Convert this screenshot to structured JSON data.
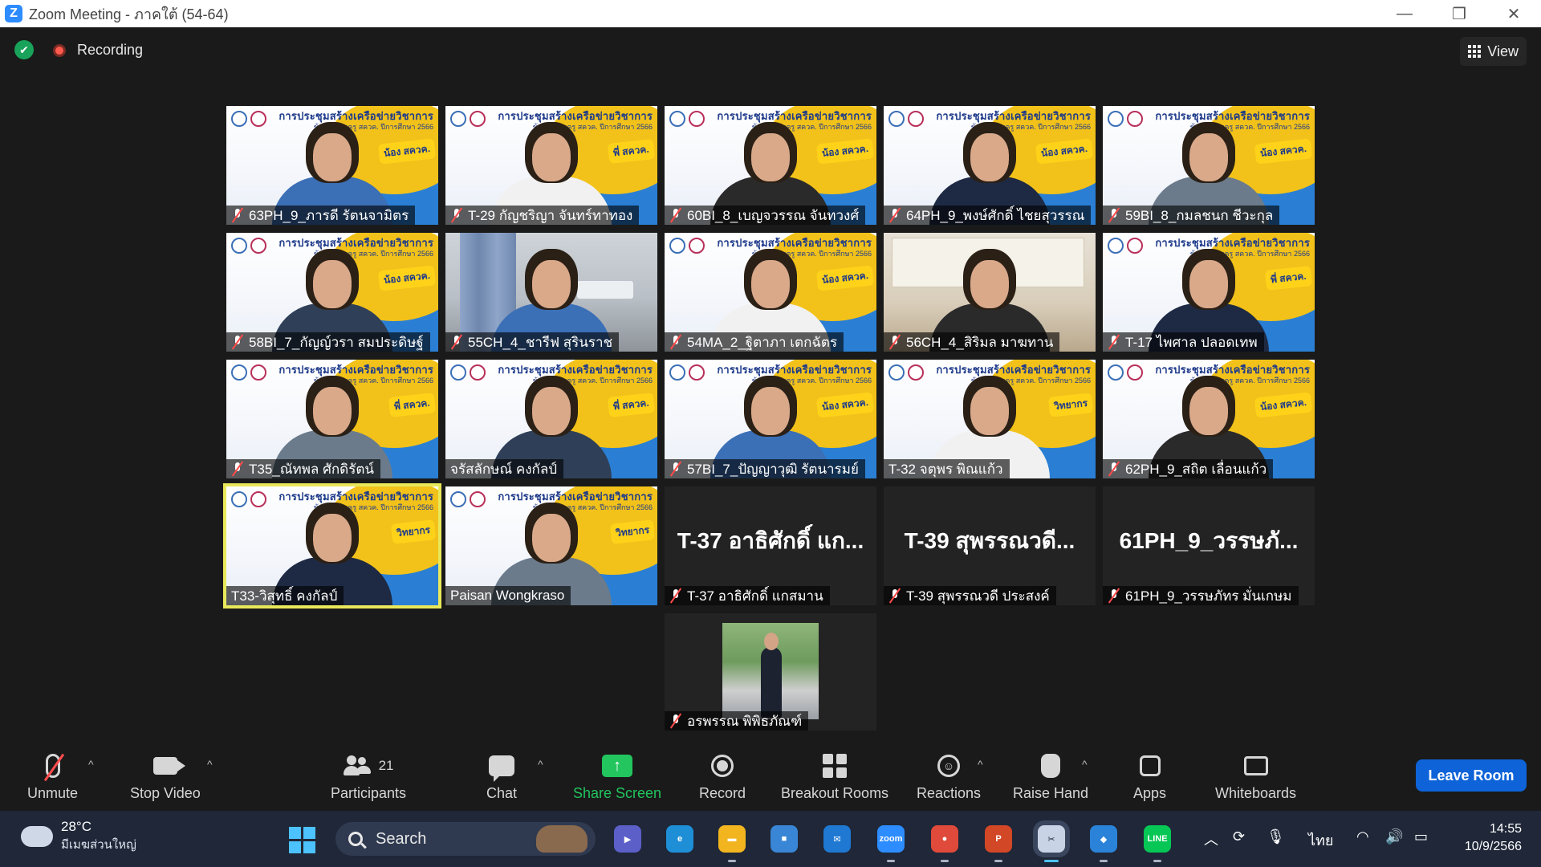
{
  "window": {
    "title": "Zoom Meeting - ภาคใต้ (54-64)",
    "controls": {
      "minimize": "—",
      "restore": "❐",
      "close": "✕"
    }
  },
  "topbar": {
    "security_icon": "shield-check-icon",
    "recording_label": "Recording",
    "view_label": "View"
  },
  "banner": {
    "title": "การประชุมสร้างเครือข่ายวิชาการ",
    "subtitle": "ข้าราชการครู สควค. ปีการศึกษา 2566",
    "tag_student": "น้อง สควค.",
    "tag_senior": "พี่ สควค.",
    "tag_speaker": "วิทยากร"
  },
  "participants": [
    {
      "name": "63PH_9_ภารดี รัตนจามิตร",
      "muted": true,
      "video": "banner",
      "tag": "student"
    },
    {
      "name": "T-29 กัญชริญา  จันทร์ทาทอง",
      "muted": true,
      "video": "banner",
      "tag": "senior"
    },
    {
      "name": "60BI_8_เบญจวรรณ จันทวงศ์",
      "muted": true,
      "video": "banner",
      "tag": "student"
    },
    {
      "name": "64PH_9_พงษ์ศักดิ์ ไชยสุวรรณ",
      "muted": true,
      "video": "banner",
      "tag": "student"
    },
    {
      "name": "59BI_8_กมลชนก ชีวะกุล",
      "muted": true,
      "video": "banner",
      "tag": "student"
    },
    {
      "name": "58BI_7_กัญญ์วรา สมประดิษฐ์",
      "muted": true,
      "video": "banner",
      "tag": "student"
    },
    {
      "name": "55CH_4_ชารีฟ สุรินราช",
      "muted": true,
      "video": "room",
      "tag": ""
    },
    {
      "name": "54MA_2_ฐิตาภา เตกฉัตร",
      "muted": true,
      "video": "banner",
      "tag": "student"
    },
    {
      "name": "56CH_4_สิริมล มาฆทาน",
      "muted": true,
      "video": "office",
      "tag": ""
    },
    {
      "name": "T-17 ไพศาล ปลอดเทพ",
      "muted": true,
      "video": "banner",
      "tag": "senior"
    },
    {
      "name": "T35_ณัทพล ศักดิรัตน์",
      "muted": true,
      "video": "banner",
      "tag": "senior"
    },
    {
      "name": "จรัสลักษณ์ คงกัลป์",
      "muted": false,
      "video": "banner",
      "tag": "senior"
    },
    {
      "name": "57BI_7_ปัญญาวุฒิ รัตนารมย์",
      "muted": true,
      "video": "banner",
      "tag": "student"
    },
    {
      "name": "T-32 จตุพร พิณแก้ว",
      "muted": false,
      "video": "banner",
      "tag": "speaker"
    },
    {
      "name": "62PH_9_สถิต เลื่อนแก้ว",
      "muted": true,
      "video": "banner",
      "tag": "student"
    },
    {
      "name": "T33-วิสุทธิ์ คงกัลป์",
      "muted": false,
      "video": "banner",
      "tag": "speaker",
      "active_speaker": true
    },
    {
      "name": "Paisan Wongkraso",
      "muted": false,
      "video": "banner",
      "tag": "speaker"
    },
    {
      "name": "T-37 อาธิศักดิ์ แกสมาน",
      "muted": true,
      "video": "off",
      "display": "T-37 อาธิศักดิ์ แก..."
    },
    {
      "name": "T-39 สุพรรณวดี ประสงค์",
      "muted": true,
      "video": "off",
      "display": "T-39 สุพรรณวดี..."
    },
    {
      "name": "61PH_9_วรรษภัทร มั่นเกษม",
      "muted": true,
      "video": "off",
      "display": "61PH_9_วรรษภั..."
    },
    {
      "name": "อรพรรณ พิพิธภัณฑ์",
      "muted": true,
      "video": "photo"
    }
  ],
  "toolbar": {
    "unmute": "Unmute",
    "stop_video": "Stop Video",
    "participants": "Participants",
    "participants_count": "21",
    "chat": "Chat",
    "share_screen": "Share Screen",
    "share_icon": "↑",
    "record": "Record",
    "breakout_rooms": "Breakout Rooms",
    "reactions": "Reactions",
    "raise_hand": "Raise Hand",
    "apps": "Apps",
    "whiteboards": "Whiteboards",
    "leave": "Leave Room",
    "caret": "^"
  },
  "taskbar": {
    "temperature": "28°C",
    "location": "มีเมฆส่วนใหญ่",
    "search_label": "Search",
    "apps": [
      {
        "name": "meet",
        "label": "▶",
        "color": "#5b5fc7"
      },
      {
        "name": "edge",
        "label": "e",
        "color": "#1e8fd6"
      },
      {
        "name": "explorer",
        "label": "▬",
        "color": "#f2b51f"
      },
      {
        "name": "store",
        "label": "■",
        "color": "#3a86d6"
      },
      {
        "name": "mail",
        "label": "✉",
        "color": "#1f78d1"
      },
      {
        "name": "zoom",
        "label": "zoom",
        "color": "#2d8cff"
      },
      {
        "name": "chrome",
        "label": "●",
        "color": "#e04a3a"
      },
      {
        "name": "powerpoint",
        "label": "P",
        "color": "#d24726"
      },
      {
        "name": "snipping",
        "label": "✂",
        "color": "#c9d3e6"
      },
      {
        "name": "photos",
        "label": "◆",
        "color": "#2a83d8"
      },
      {
        "name": "line",
        "label": "LINE",
        "color": "#06c755"
      }
    ],
    "tray_lang": "ไทย",
    "time": "14:55",
    "date": "10/9/2566"
  }
}
